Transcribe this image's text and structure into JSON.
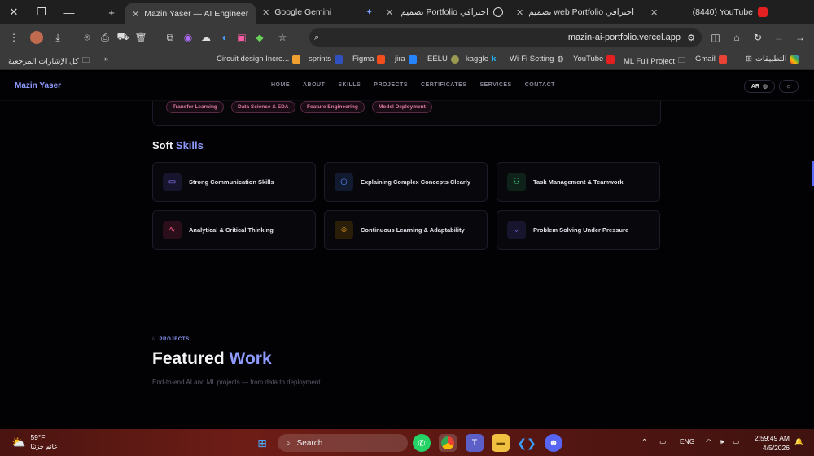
{
  "browser": {
    "tabs": [
      {
        "title": "Mazin Yaser — AI Engineer",
        "active": true
      },
      {
        "title": "Google Gemini",
        "active": false
      },
      {
        "title": "تصميم Portfolio احترافي",
        "active": false
      },
      {
        "title": "تصميم web Portfolio احترافي",
        "active": false
      },
      {
        "title": "(8440) YouTube",
        "active": false
      }
    ],
    "new_tab": "+",
    "url": "mazin-ai-portfolio.vercel.app",
    "bookmarks": [
      {
        "label": "كل الإشارات المرجعية"
      },
      {
        "label": "Circuit design Incre..."
      },
      {
        "label": "sprints"
      },
      {
        "label": "Figma"
      },
      {
        "label": "jira"
      },
      {
        "label": "EELU"
      },
      {
        "label": "kaggle"
      },
      {
        "label": "Wi-Fi Setting"
      },
      {
        "label": "YouTube"
      },
      {
        "label": "ML Full Project"
      },
      {
        "label": "Gmail"
      },
      {
        "label": "التطبيقات"
      }
    ],
    "bookmarks_overflow": "»"
  },
  "site": {
    "brand": "Mazin Yaser",
    "nav": [
      "HOME",
      "ABOUT",
      "SKILLS",
      "PROJECTS",
      "CERTIFICATES",
      "SERVICES",
      "CONTACT"
    ],
    "lang_toggle": "AR",
    "chips": [
      "Transfer Learning",
      "Data Science & EDA",
      "Feature Engineering",
      "Model Deployment"
    ],
    "soft_title_a": "Soft",
    "soft_title_b": "Skills",
    "soft_skills": [
      {
        "label": "Strong Communication Skills",
        "icon": "chat-icon",
        "color": "#8b7cff"
      },
      {
        "label": "Explaining Complex Concepts Clearly",
        "icon": "clock-icon",
        "color": "#5b8cff"
      },
      {
        "label": "Task Management & Teamwork",
        "icon": "team-icon",
        "color": "#3fd08a"
      },
      {
        "label": "Analytical & Critical Thinking",
        "icon": "pulse-icon",
        "color": "#ff5c8a"
      },
      {
        "label": "Continuous Learning & Adaptability",
        "icon": "smile-icon",
        "color": "#ffb020"
      },
      {
        "label": "Problem Solving Under Pressure",
        "icon": "shield-icon",
        "color": "#8b7cff"
      }
    ],
    "projects_tag": "PROJECTS",
    "projects_tag_prefix": "//",
    "featured_a": "Featured",
    "featured_b": "Work",
    "featured_sub": "End-to-end AI and ML projects — from data to deployment."
  },
  "taskbar": {
    "temp": "59°F",
    "weather_text": "غائم جزئيًا",
    "search": "Search",
    "lang": "ENG",
    "time": "2:59:49 AM",
    "date": "4/5/2026"
  }
}
